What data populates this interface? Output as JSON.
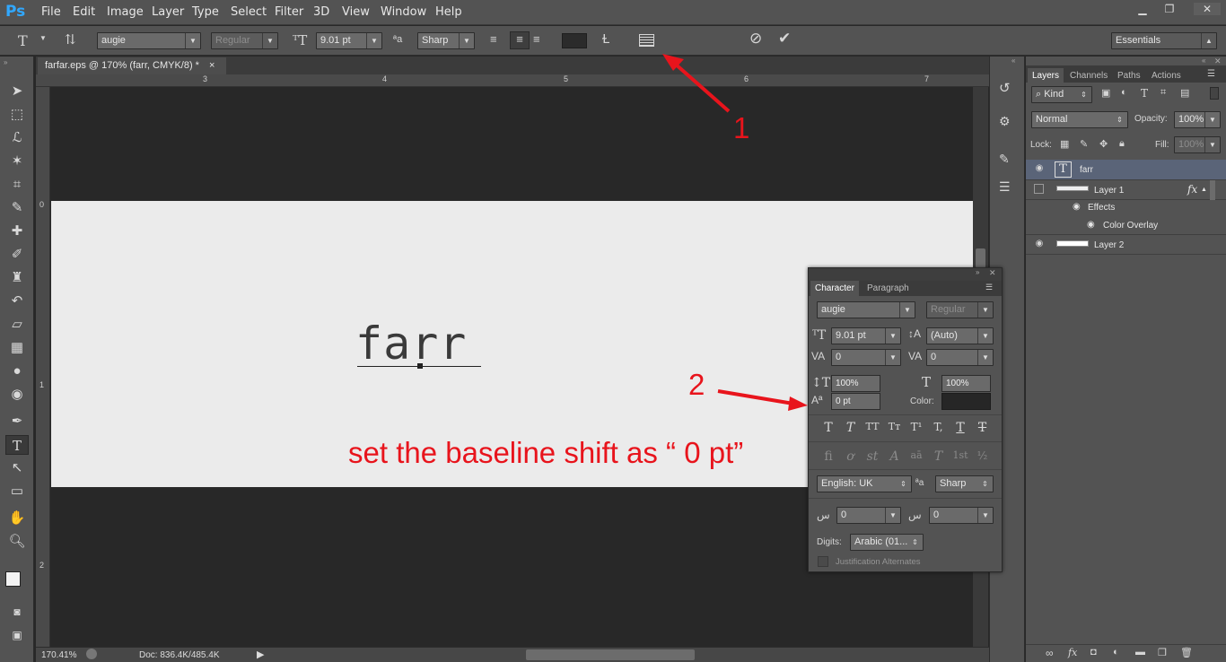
{
  "app": {
    "logo": "Ps"
  },
  "menu": [
    "File",
    "Edit",
    "Image",
    "Layer",
    "Type",
    "Select",
    "Filter",
    "3D",
    "View",
    "Window",
    "Help"
  ],
  "window_controls": {
    "minimize": "▁",
    "restore": "❐",
    "close": "✕"
  },
  "options": {
    "font_family": "augie",
    "font_style": "Regular",
    "font_size": "9.01 pt",
    "antialias": "Sharp",
    "workspace": "Essentials"
  },
  "document": {
    "tab_title": "farfar.eps @ 170% (farr, CMYK/8) *",
    "tab_close": "×",
    "canvas_text": "farr",
    "zoom": "170.41%",
    "doc_size": "Doc: 836.4K/485.4K"
  },
  "rulers": {
    "top": [
      "3",
      "4",
      "5",
      "6",
      "7"
    ],
    "left": [
      "0",
      "1",
      "2"
    ]
  },
  "layers_panel": {
    "tabs": [
      "Layers",
      "Channels",
      "Paths",
      "Actions"
    ],
    "filter_kind": "Kind",
    "blend_mode": "Normal",
    "opacity_label": "Opacity:",
    "opacity": "100%",
    "lock_label": "Lock:",
    "fill_label": "Fill:",
    "fill": "100%",
    "layers": [
      {
        "name": "farr",
        "thumb": "T"
      },
      {
        "name": "Layer 1",
        "fx": "fx"
      },
      {
        "name": "Effects"
      },
      {
        "name": "Color Overlay"
      },
      {
        "name": "Layer 2"
      }
    ]
  },
  "character_panel": {
    "tabs": [
      "Character",
      "Paragraph"
    ],
    "font_family": "augie",
    "font_style": "Regular",
    "size": "9.01 pt",
    "leading": "(Auto)",
    "kerning": "0",
    "tracking": "0",
    "vertical_scale": "100%",
    "horizontal_scale": "100%",
    "baseline_shift": "0 pt",
    "color_label": "Color:",
    "style_glyphs": [
      "T",
      "T",
      "TT",
      "Tт",
      "T¹",
      "T,",
      "T",
      "T"
    ],
    "opentype_glyphs": [
      "fi",
      "ơ",
      "st",
      "A",
      "aā",
      "T",
      "1st",
      "½"
    ],
    "language": "English: UK",
    "antialias_label": "ªa",
    "antialias": "Sharp",
    "arabic_left": "0",
    "arabic_right": "0",
    "digits_label": "Digits:",
    "digits": "Arabic (01...",
    "justification": "Justification Alternates"
  },
  "annotations": {
    "label1": "1",
    "label2": "2",
    "instruction": "set the baseline shift as “ 0 pt”"
  }
}
